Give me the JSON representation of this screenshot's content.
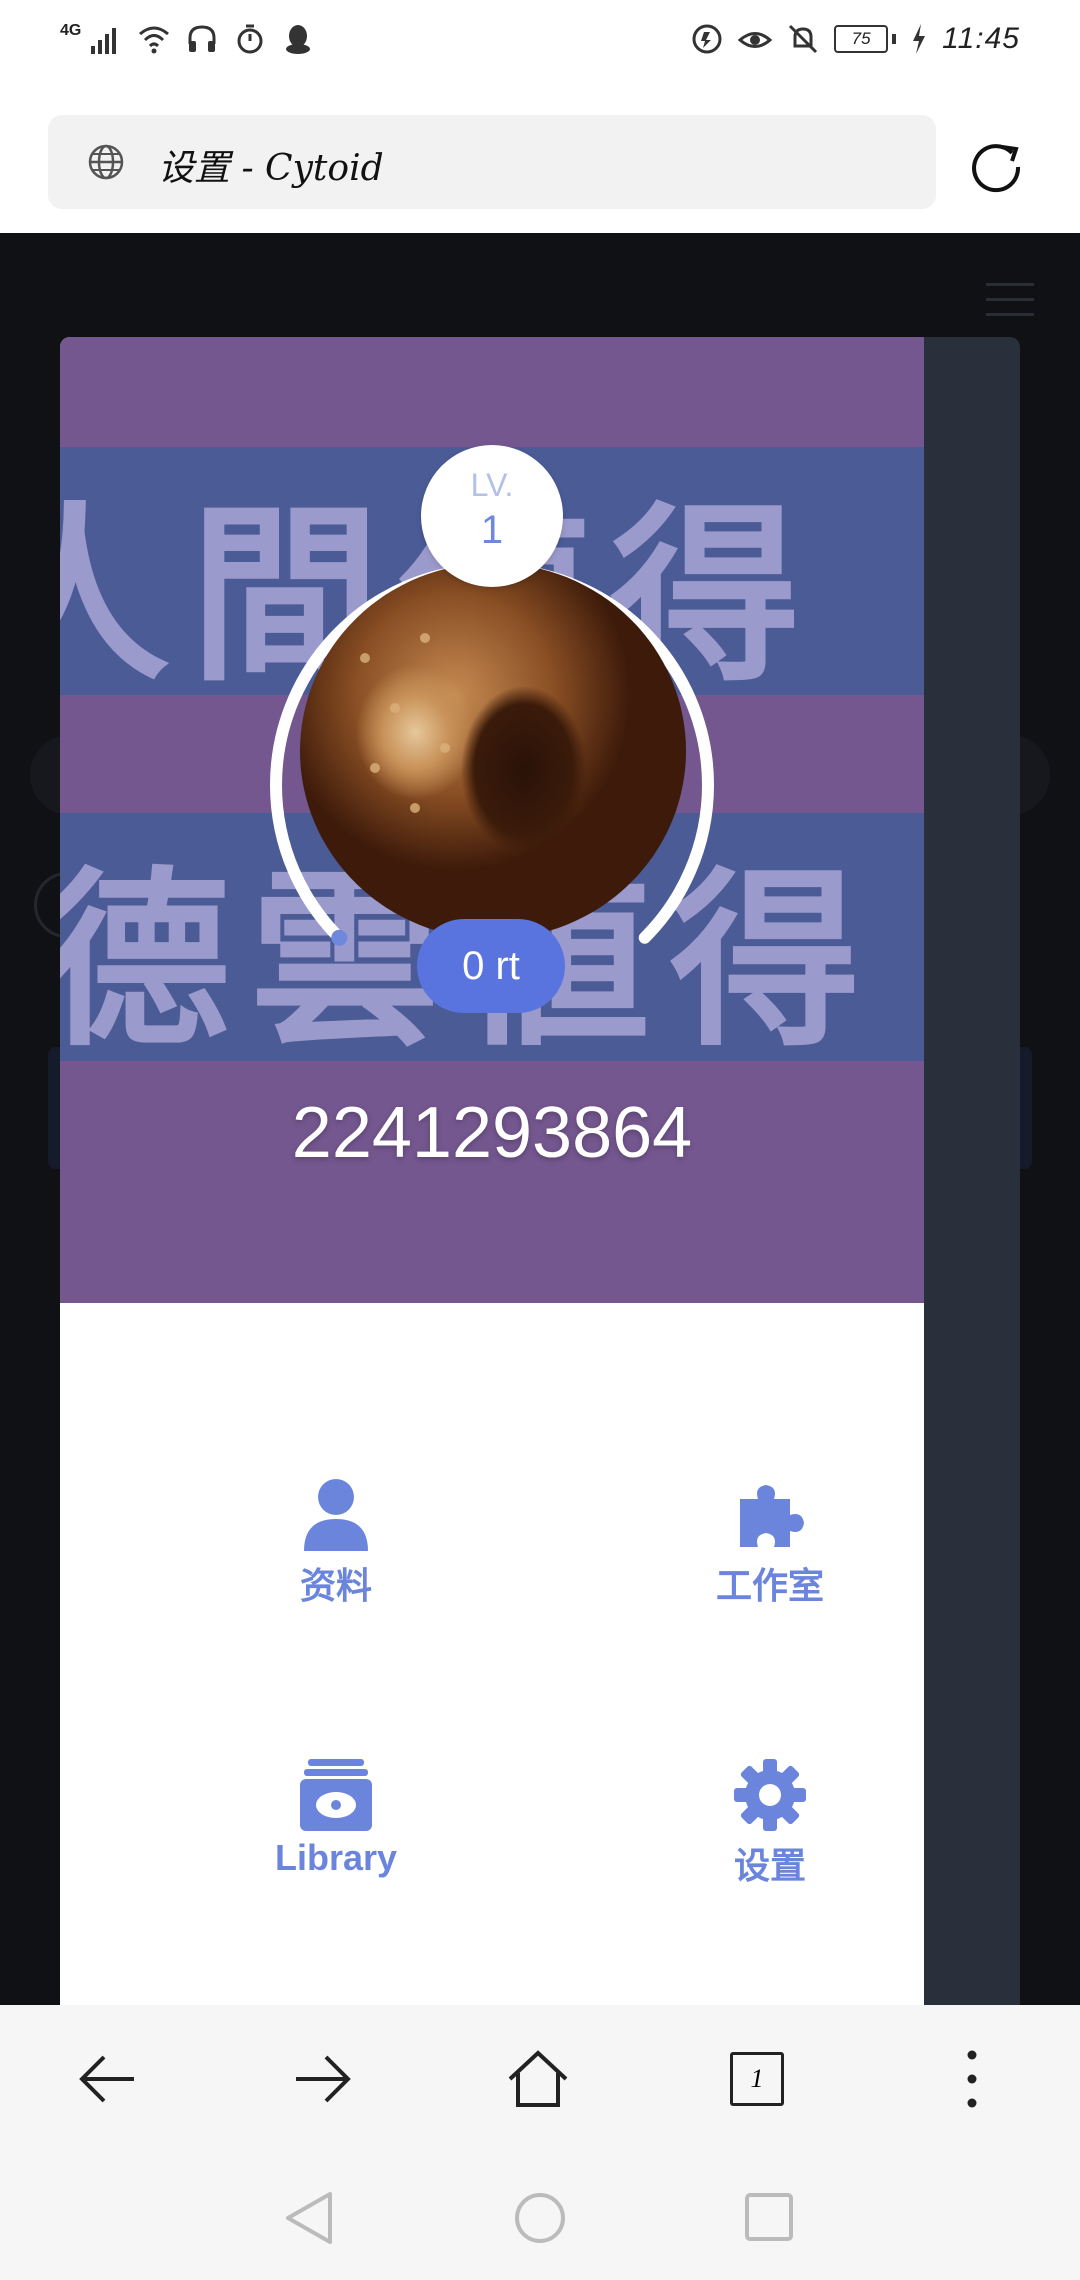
{
  "status_bar": {
    "network": "4G",
    "battery_level": "75",
    "time": "11:45",
    "icons_left": [
      "signal-icon",
      "wifi-icon",
      "headset-icon",
      "timer-icon",
      "qq-icon"
    ],
    "icons_right": [
      "data-saver-icon",
      "eye-comfort-icon",
      "mute-icon",
      "battery-icon",
      "charging-icon"
    ]
  },
  "address_bar": {
    "title": "设置 - Cytoid"
  },
  "profile": {
    "level_label": "LV.",
    "level": "1",
    "rating": "0 rt",
    "level_progress": 0.72,
    "user_id": "2241293864",
    "background_text_line1": "人間値得",
    "background_text_line2": "德雲値得"
  },
  "menu": {
    "items": [
      {
        "label": "资料",
        "icon": "user-icon"
      },
      {
        "label": "工作室",
        "icon": "puzzle-icon"
      },
      {
        "label": "Library",
        "icon": "library-disc-icon"
      },
      {
        "label": "设置",
        "icon": "gear-icon"
      }
    ]
  },
  "toolbar": {
    "tab_count": "1"
  },
  "colors": {
    "accent": "#6b85dc",
    "hero_purple": "#74578f",
    "hero_band": "#4b5b96",
    "rating_pill": "#5a74df"
  }
}
